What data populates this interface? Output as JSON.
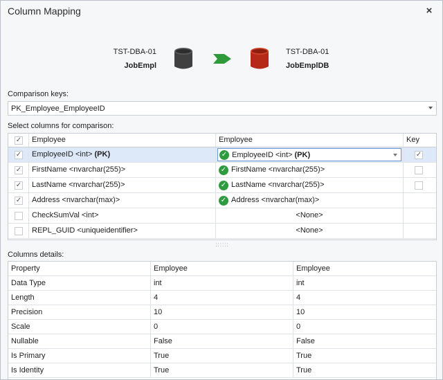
{
  "window": {
    "title": "Column Mapping",
    "close_label": "×"
  },
  "header": {
    "source": {
      "server": "TST-DBA-01",
      "database": "JobEmpl",
      "icon": "database-icon",
      "color": "#404040"
    },
    "target": {
      "server": "TST-DBA-01",
      "database": "JobEmplDB",
      "icon": "database-icon",
      "color": "#b52a16"
    },
    "arrow": {
      "icon": "arrow-right-icon",
      "color": "#2f9a3a"
    }
  },
  "comparison_keys": {
    "label": "Comparison keys:",
    "value": "PK_Employee_EmployeeID"
  },
  "mapping": {
    "label": "Select columns for comparison:",
    "headers": {
      "source": "Employee",
      "target": "Employee",
      "key": "Key"
    },
    "rows": [
      {
        "checked": true,
        "source_name": "EmployeeID",
        "source_type": " <int> ",
        "source_suffix": "(PK)",
        "target_name": "EmployeeID",
        "target_type": " <int> ",
        "target_suffix": "(PK)",
        "target_ok": true,
        "key": true,
        "key_enabled": true,
        "selected": true
      },
      {
        "checked": true,
        "source_name": "FirstName",
        "source_type": " <nvarchar(255)>",
        "source_suffix": "",
        "target_name": "FirstName",
        "target_type": " <nvarchar(255)>",
        "target_suffix": "",
        "target_ok": true,
        "key": false,
        "key_enabled": true,
        "selected": false
      },
      {
        "checked": true,
        "source_name": "LastName",
        "source_type": " <nvarchar(255)>",
        "source_suffix": "",
        "target_name": "LastName",
        "target_type": " <nvarchar(255)>",
        "target_suffix": "",
        "target_ok": true,
        "key": false,
        "key_enabled": true,
        "selected": false
      },
      {
        "checked": true,
        "source_name": "Address",
        "source_type": " <nvarchar(max)>",
        "source_suffix": "",
        "target_name": "Address",
        "target_type": " <nvarchar(max)>",
        "target_suffix": "",
        "target_ok": true,
        "key": false,
        "key_enabled": false,
        "selected": false
      },
      {
        "checked": false,
        "source_name": "CheckSumVal",
        "source_type": " <int>",
        "source_suffix": "",
        "target_none": "<None>",
        "target_ok": false,
        "key": false,
        "key_enabled": false,
        "selected": false
      },
      {
        "checked": false,
        "source_name": "REPL_GUID",
        "source_type": " <uniqueidentifier>",
        "source_suffix": "",
        "target_none": "<None>",
        "target_ok": false,
        "key": false,
        "key_enabled": false,
        "selected": false
      }
    ]
  },
  "details": {
    "label": "Columns details:",
    "headers": {
      "property": "Property",
      "source": "Employee",
      "target": "Employee"
    },
    "rows": [
      {
        "property": "Data Type",
        "source": "int",
        "target": "int"
      },
      {
        "property": "Length",
        "source": "4",
        "target": "4"
      },
      {
        "property": "Precision",
        "source": "10",
        "target": "10"
      },
      {
        "property": "Scale",
        "source": "0",
        "target": "0"
      },
      {
        "property": "Nullable",
        "source": "False",
        "target": "False"
      },
      {
        "property": "Is Primary",
        "source": "True",
        "target": "True"
      },
      {
        "property": "Is Identity",
        "source": "True",
        "target": "True"
      }
    ]
  }
}
